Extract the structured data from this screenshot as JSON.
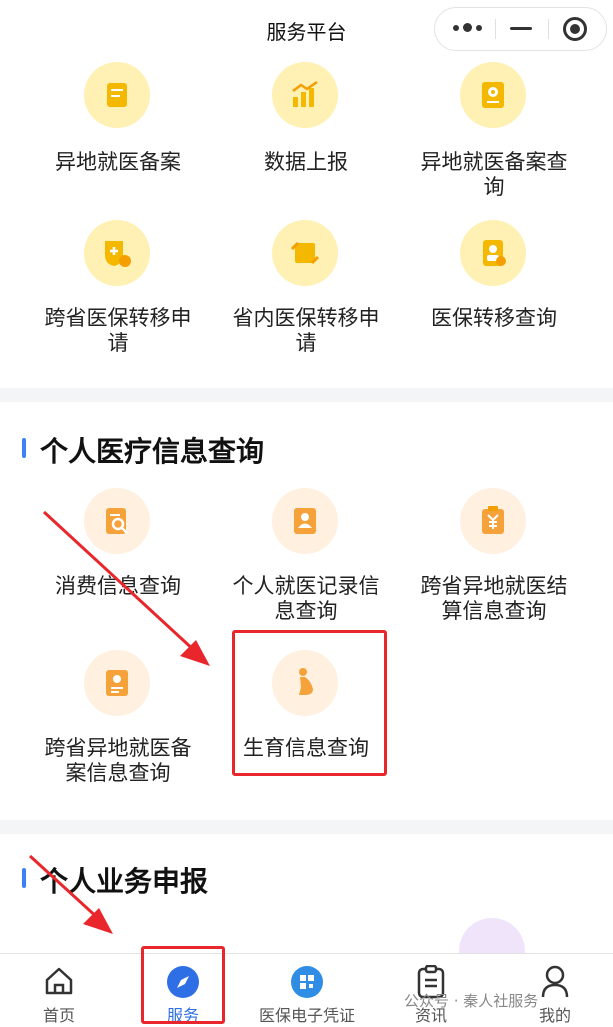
{
  "header": {
    "title": "服务平台"
  },
  "section_top": {
    "tiles": [
      {
        "label": "异地就医备案",
        "icon": "document-icon"
      },
      {
        "label": "数据上报",
        "icon": "bar-chart-icon"
      },
      {
        "label": "异地就医备案查\n询",
        "icon": "location-doc-icon"
      },
      {
        "label": "跨省医保转移申\n请",
        "icon": "transfer-doc-icon"
      },
      {
        "label": "省内医保转移申\n请",
        "icon": "swap-doc-icon"
      },
      {
        "label": "医保转移查询",
        "icon": "id-card-icon"
      }
    ]
  },
  "section_medical": {
    "title": "个人医疗信息查询",
    "tiles": [
      {
        "label": "消费信息查询",
        "icon": "search-doc-icon"
      },
      {
        "label": "个人就医记录信\n息查询",
        "icon": "person-doc-icon"
      },
      {
        "label": "跨省异地就医结\n算信息查询",
        "icon": "yuan-doc-icon"
      },
      {
        "label": "跨省异地就医备\n案信息查询",
        "icon": "location-file-icon"
      },
      {
        "label": "生育信息查询",
        "icon": "pregnant-icon"
      }
    ]
  },
  "section_business": {
    "title": "个人业务申报"
  },
  "tabbar": {
    "tabs": [
      {
        "label": "首页",
        "icon": "home-icon"
      },
      {
        "label": "服务",
        "icon": "compass-icon",
        "active": true
      },
      {
        "label": "医保电子凭证",
        "icon": "qr-code-icon"
      },
      {
        "label": "资讯",
        "icon": "clipboard-icon"
      },
      {
        "label": "我的",
        "icon": "user-icon"
      }
    ]
  },
  "watermark": "公众号 · 秦人社服务",
  "colors": {
    "accent": "#2f6fe5",
    "highlight": "#e8262b",
    "icon_yellow": "#f5b800",
    "icon_orange": "#f6a23a"
  }
}
